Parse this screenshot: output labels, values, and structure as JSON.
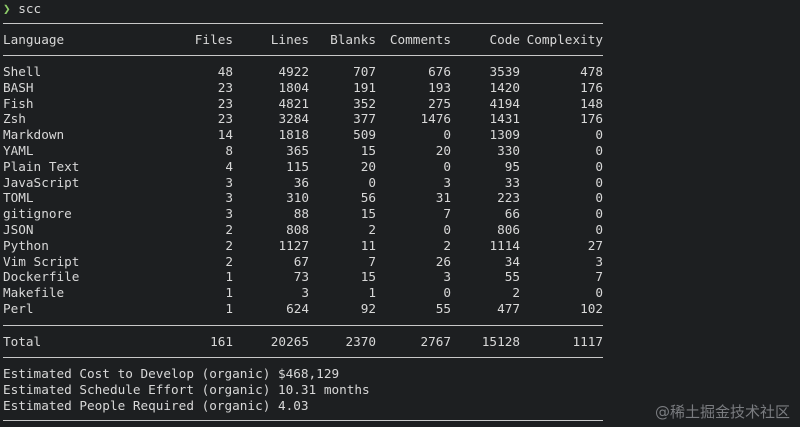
{
  "prompt": {
    "symbol": "❯",
    "command": "scc"
  },
  "table": {
    "headers": [
      "Language",
      "Files",
      "Lines",
      "Blanks",
      "Comments",
      "Code",
      "Complexity"
    ],
    "rows": [
      [
        "Shell",
        "48",
        "4922",
        "707",
        "676",
        "3539",
        "478"
      ],
      [
        "BASH",
        "23",
        "1804",
        "191",
        "193",
        "1420",
        "176"
      ],
      [
        "Fish",
        "23",
        "4821",
        "352",
        "275",
        "4194",
        "148"
      ],
      [
        "Zsh",
        "23",
        "3284",
        "377",
        "1476",
        "1431",
        "176"
      ],
      [
        "Markdown",
        "14",
        "1818",
        "509",
        "0",
        "1309",
        "0"
      ],
      [
        "YAML",
        "8",
        "365",
        "15",
        "20",
        "330",
        "0"
      ],
      [
        "Plain Text",
        "4",
        "115",
        "20",
        "0",
        "95",
        "0"
      ],
      [
        "JavaScript",
        "3",
        "36",
        "0",
        "3",
        "33",
        "0"
      ],
      [
        "TOML",
        "3",
        "310",
        "56",
        "31",
        "223",
        "0"
      ],
      [
        "gitignore",
        "3",
        "88",
        "15",
        "7",
        "66",
        "0"
      ],
      [
        "JSON",
        "2",
        "808",
        "2",
        "0",
        "806",
        "0"
      ],
      [
        "Python",
        "2",
        "1127",
        "11",
        "2",
        "1114",
        "27"
      ],
      [
        "Vim Script",
        "2",
        "67",
        "7",
        "26",
        "34",
        "3"
      ],
      [
        "Dockerfile",
        "1",
        "73",
        "15",
        "3",
        "55",
        "7"
      ],
      [
        "Makefile",
        "1",
        "3",
        "1",
        "0",
        "2",
        "0"
      ],
      [
        "Perl",
        "1",
        "624",
        "92",
        "55",
        "477",
        "102"
      ]
    ],
    "total": [
      "Total",
      "161",
      "20265",
      "2370",
      "2767",
      "15128",
      "1117"
    ]
  },
  "estimates": {
    "cost": "Estimated Cost to Develop (organic) $468,129",
    "schedule": "Estimated Schedule Effort (organic) 10.31 months",
    "people": "Estimated People Required (organic) 4.03"
  },
  "watermark": "@稀土掘金技术社区",
  "colors": {
    "background": "#1d1f21",
    "foreground": "#d8d8d8",
    "prompt_accent": "#8fce6a",
    "rule": "#c8c8c8"
  }
}
